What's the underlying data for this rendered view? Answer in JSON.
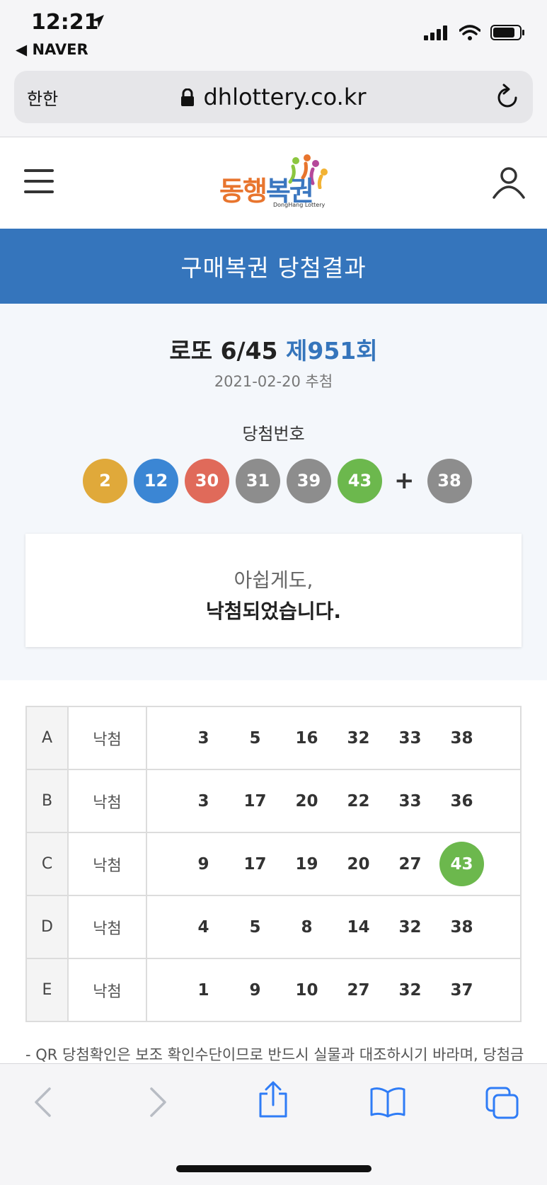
{
  "status": {
    "time": "12:21",
    "back_app": "◀ NAVER"
  },
  "browser": {
    "reader_label": "한한",
    "url": "dhlottery.co.kr"
  },
  "site": {
    "logo_text_a": "동행",
    "logo_text_b": "복권",
    "logo_sub": "DongHang Lottery"
  },
  "page": {
    "title": "구매복권 당첨결과"
  },
  "draw": {
    "game": "로또 6/45",
    "round": "제951회",
    "date": "2021-02-20 추첨",
    "winning_label": "당첨번호",
    "numbers": [
      "2",
      "12",
      "30",
      "31",
      "39",
      "43"
    ],
    "number_colors": [
      "#e0a93a",
      "#3b86d4",
      "#e06a5a",
      "#8d8d8d",
      "#8d8d8d",
      "#6cb84d"
    ],
    "plus": "+",
    "bonus": "38",
    "bonus_color": "#8d8d8d"
  },
  "message": {
    "line1": "아쉽게도,",
    "line2": "낙첨되었습니다."
  },
  "tickets": [
    {
      "game": "A",
      "result": "낙첨",
      "numbers": [
        "3",
        "5",
        "16",
        "32",
        "33",
        "38"
      ],
      "hits": []
    },
    {
      "game": "B",
      "result": "낙첨",
      "numbers": [
        "3",
        "17",
        "20",
        "22",
        "33",
        "36"
      ],
      "hits": []
    },
    {
      "game": "C",
      "result": "낙첨",
      "numbers": [
        "9",
        "17",
        "19",
        "20",
        "27",
        "43"
      ],
      "hits": [
        5
      ]
    },
    {
      "game": "D",
      "result": "낙첨",
      "numbers": [
        "4",
        "5",
        "8",
        "14",
        "32",
        "38"
      ],
      "hits": []
    },
    {
      "game": "E",
      "result": "낙첨",
      "numbers": [
        "1",
        "9",
        "10",
        "27",
        "32",
        "37"
      ],
      "hits": []
    }
  ],
  "footnote": "- QR 당첨확인은 보조 확인수단이므로 반드시 실물과 대조하시기 바라며, 당첨금",
  "colors": {
    "brand_blue": "#3575bc",
    "hit_green": "#6cb84d"
  }
}
